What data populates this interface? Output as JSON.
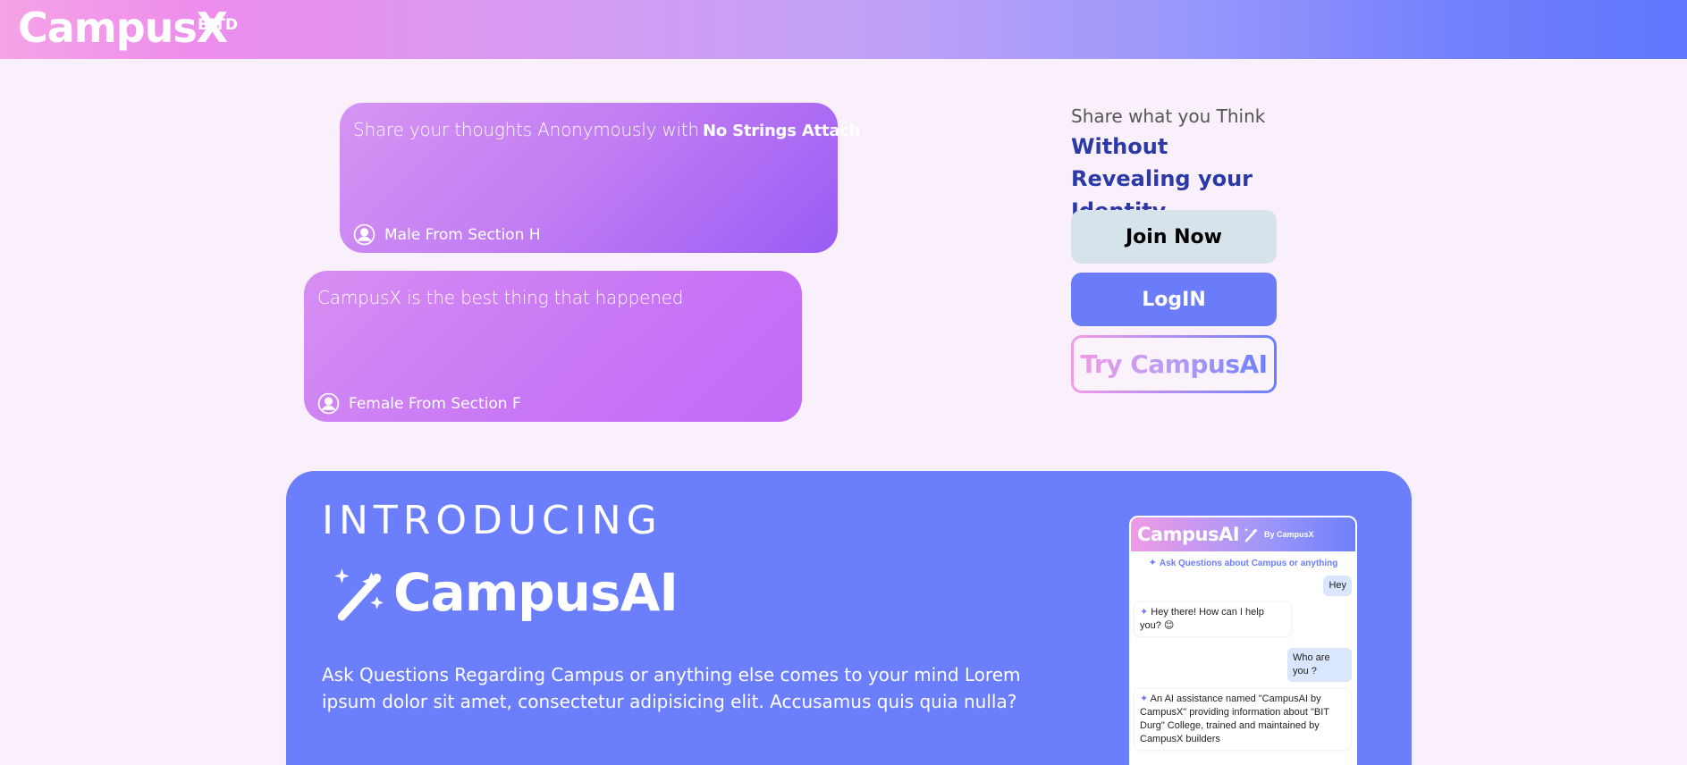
{
  "header": {
    "brand": "CampusX",
    "brand_sup": "BITD"
  },
  "posts": [
    {
      "text": "Share your thoughts Anonymously with",
      "emphasis": "No Strings Attach",
      "author": "Male From Section H"
    },
    {
      "text": "CampusX is the best thing that happened",
      "emphasis": "",
      "author": "Female From Section F"
    }
  ],
  "hero": {
    "tagline": "Share what you Think",
    "headline": "Without Revealing your Identity",
    "join_label": "Join Now",
    "login_label": "LogIN",
    "try_label": "Try CampusAI"
  },
  "intro": {
    "kicker": "INTRODUCING",
    "title": "CampusAI",
    "description": "Ask Questions Regarding Campus or anything else comes to your mind Lorem ipsum dolor sit amet, consectetur adipisicing elit. Accusamus quis quia nulla?"
  },
  "chat": {
    "title": "CampusAI",
    "by": "By CampusX",
    "subtitle": "Ask Questions about Campus or anything",
    "messages": [
      {
        "role": "user",
        "text": "Hey"
      },
      {
        "role": "bot",
        "text": "Hey there! How can I help you? 😊"
      },
      {
        "role": "user",
        "text": "Who are you ?"
      },
      {
        "role": "bot",
        "text": "An AI assistance named \"CampusAI by CampusX\" providing information about \"BIT Durg\" College, trained and maintained by CampusX builders"
      }
    ]
  },
  "colors": {
    "accent": "#6b7cfb",
    "headline": "#2b3aa6",
    "panel": "#6b7efc"
  }
}
